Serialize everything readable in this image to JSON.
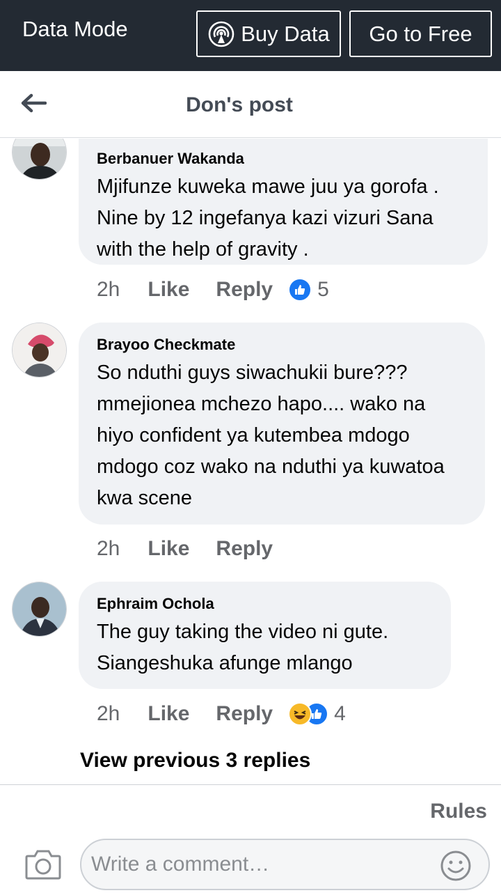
{
  "databar": {
    "mode_label": "Data Mode",
    "buy_label": "Buy Data",
    "free_label": "Go to Free"
  },
  "header": {
    "title": "Don's post"
  },
  "comments": [
    {
      "author": "Berbanuer Wakanda",
      "text": "Mjifunze kuweka mawe juu ya gorofa . Nine by 12 ingefanya kazi vizuri Sana with the help of gravity .",
      "time": "2h",
      "like_label": "Like",
      "reply_label": "Reply",
      "reaction_count": "5",
      "reactions": [
        "like-icon"
      ]
    },
    {
      "author": "Brayoo Checkmate",
      "text": "So nduthi guys siwachukii bure???mmejionea mchezo hapo.... wako na hiyo confident ya kutembea mdogo mdogo coz wako na nduthi ya kuwatoa kwa scene",
      "time": "2h",
      "like_label": "Like",
      "reply_label": "Reply"
    },
    {
      "author": "Ephraim Ochola",
      "text": "The guy taking the video ni gute. Siangeshuka afunge mlango",
      "time": "2h",
      "like_label": "Like",
      "reply_label": "Reply",
      "reaction_count": "4",
      "reactions": [
        "haha-icon",
        "like-icon"
      ]
    }
  ],
  "view_previous": "View previous 3 replies",
  "footer": {
    "rules_label": "Rules",
    "comment_placeholder": "Write a comment…"
  },
  "colors": {
    "databar_bg": "#232a33",
    "bubble_bg": "#f0f2f5",
    "like_blue": "#1877f2",
    "haha_yellow": "#f7b928"
  }
}
